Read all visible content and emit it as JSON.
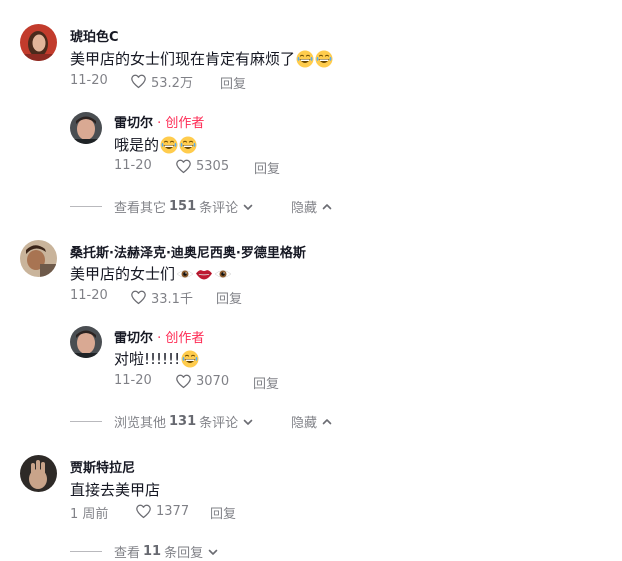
{
  "comments": [
    {
      "username": "琥珀色C",
      "text": "美甲店的女士们现在肯定有麻烦了",
      "emojis": [
        "grinning-sweat-emoji",
        "grinning-sweat-emoji"
      ],
      "date": "11-20",
      "likes": "53.2万",
      "reply_label": "回复",
      "replies": [
        {
          "username": "雷切尔",
          "creator_label": " · 创作者",
          "text": "哦是的",
          "emojis": [
            "grinning-sweat-emoji",
            "grinning-sweat-emoji"
          ],
          "date": "11-20",
          "likes": "5305",
          "reply_label": "回复"
        }
      ],
      "more": {
        "prefix": "查看其它",
        "count": "151",
        "suffix": "条评论",
        "hide_label": "隐藏"
      }
    },
    {
      "username": "桑托斯·法赫泽克·迪奥尼西奥·罗德里格斯",
      "text": "美甲店的女士们",
      "emojis": [
        "eye-emoji",
        "lips-emoji",
        "eye-emoji"
      ],
      "date": "11-20",
      "likes": "33.1千",
      "reply_label": "回复",
      "replies": [
        {
          "username": "雷切尔",
          "creator_label": " · 创作者",
          "text": "对啦!!!!!!",
          "emojis": [
            "grinning-sweat-emoji"
          ],
          "date": "11-20",
          "likes": "3070",
          "reply_label": "回复"
        }
      ],
      "more": {
        "prefix": "浏览其他",
        "count": "131",
        "suffix": "条评论",
        "hide_label": "隐藏"
      }
    },
    {
      "username": "贾斯特拉尼",
      "text": "直接去美甲店",
      "emojis": [],
      "date": "1 周前",
      "likes": "1377",
      "reply_label": "回复",
      "replies": [],
      "more": {
        "prefix": "查看",
        "count": "11",
        "suffix": "条回复",
        "hide_label": ""
      }
    }
  ],
  "colors": {
    "creator": "#fe2c55",
    "text": "#161823",
    "muted": "#8a8b91"
  }
}
